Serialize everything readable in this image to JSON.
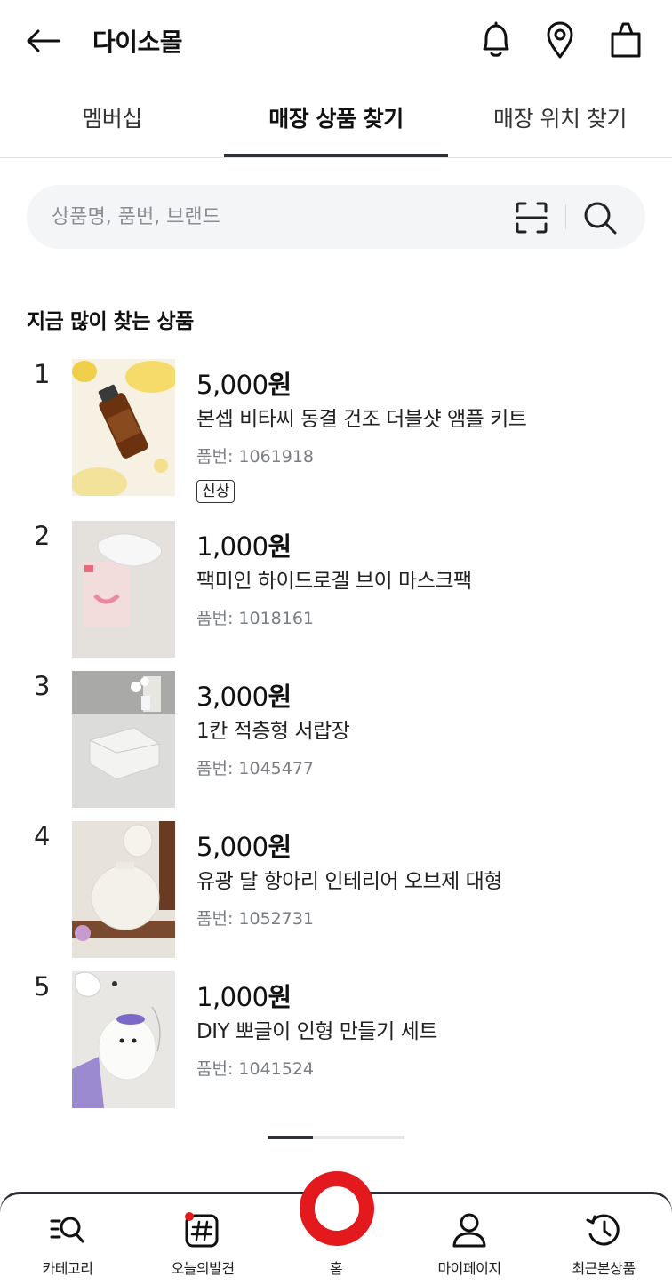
{
  "header": {
    "title": "다이소몰",
    "icons": [
      "back-arrow-icon",
      "bell-icon",
      "location-pin-icon",
      "shopping-bag-icon"
    ]
  },
  "tabs": [
    {
      "label": "멤버십",
      "active": false
    },
    {
      "label": "매장 상품 찾기",
      "active": true
    },
    {
      "label": "매장 위치 찾기",
      "active": false
    }
  ],
  "search": {
    "placeholder": "상품명, 품번, 브랜드",
    "value": ""
  },
  "section": {
    "title": "지금 많이 찾는 상품"
  },
  "products": [
    {
      "rank": "1",
      "price": "5,000",
      "currency": "원",
      "name": "본셉 비타씨 동결 건조 더블샷 앰플 키트",
      "code": "품번: 1061918",
      "badge": "신상"
    },
    {
      "rank": "2",
      "price": "1,000",
      "currency": "원",
      "name": "팩미인 하이드로겔 브이 마스크팩",
      "code": "품번: 1018161"
    },
    {
      "rank": "3",
      "price": "3,000",
      "currency": "원",
      "name": "1칸 적층형 서랍장",
      "code": "품번: 1045477"
    },
    {
      "rank": "4",
      "price": "5,000",
      "currency": "원",
      "name": "유광 달 항아리 인테리어 오브제 대형",
      "code": "품번: 1052731"
    },
    {
      "rank": "5",
      "price": "1,000",
      "currency": "원",
      "name": "DIY 뽀글이 인형 만들기 세트",
      "code": "품번: 1041524"
    }
  ],
  "pager": {
    "current_page": 1,
    "total_pages": 3
  },
  "bottom_nav": [
    {
      "label": "카테고리",
      "icon": "category-search-icon"
    },
    {
      "label": "오늘의발견",
      "icon": "hashtag-icon"
    },
    {
      "label": "홈",
      "icon": "home-ring-icon"
    },
    {
      "label": "마이페이지",
      "icon": "person-icon"
    },
    {
      "label": "최근본상품",
      "icon": "history-icon"
    }
  ],
  "colors": {
    "brand_red": "#e3191e",
    "tab_indicator": "#2b2f36",
    "search_bg": "#f4f5f7"
  }
}
